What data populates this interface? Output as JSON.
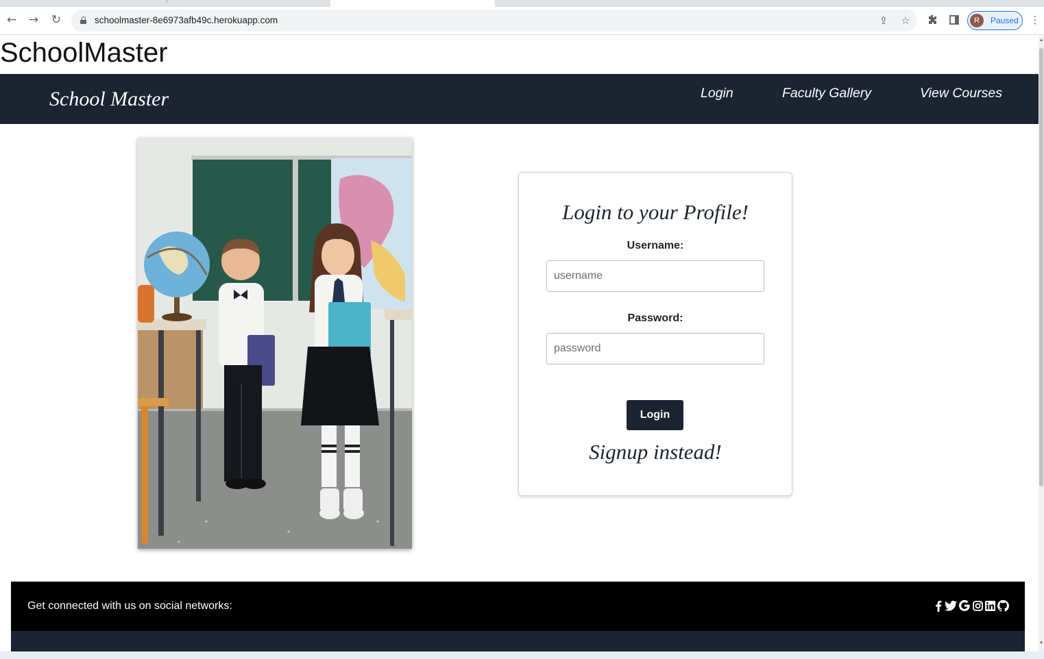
{
  "browser": {
    "url": "schoolmaster-8e6973afb49c.herokuapp.com",
    "profile_initial": "R",
    "profile_status": "Paused"
  },
  "site": {
    "heading": "SchoolMaster"
  },
  "navbar": {
    "brand": "School Master",
    "links": [
      "Login",
      "Faculty Gallery",
      "View Courses"
    ]
  },
  "login_card": {
    "title": "Login to your Profile!",
    "username_label": "Username:",
    "username_placeholder": "username",
    "username_value": "",
    "password_label": "Password:",
    "password_placeholder": "password",
    "password_value": "",
    "submit_label": "Login",
    "signup_text": "Signup instead!"
  },
  "footer": {
    "text": "Get connected with us on social networks:",
    "social_icons": [
      "facebook-icon",
      "twitter-icon",
      "google-icon",
      "instagram-icon",
      "linkedin-icon",
      "github-icon"
    ]
  },
  "colors": {
    "navbar_bg": "#1c2331",
    "footer_top_bg": "#000000",
    "button_bg": "#1c2331"
  }
}
